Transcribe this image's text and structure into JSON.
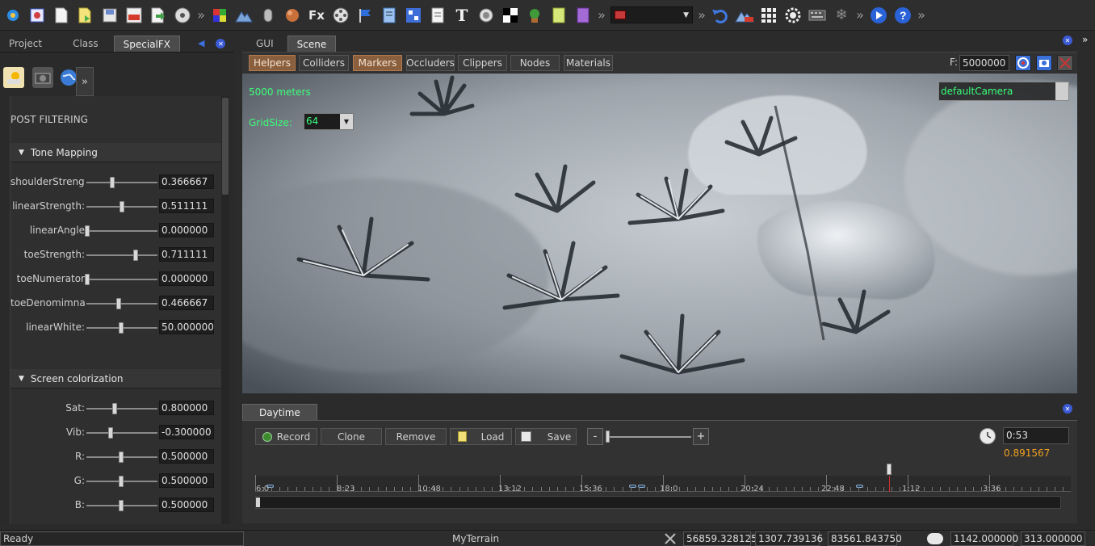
{
  "toolbar": {
    "overflow_glyph": "»",
    "fx_label": "Fx",
    "text_tool_label": "T",
    "combo_value": "",
    "icons": [
      "app-icon",
      "class-icon",
      "new-file-icon",
      "open-file-icon",
      "save-icon",
      "export-icon",
      "import-icon",
      "disc-icon",
      "cube-icon",
      "terrain-icon",
      "mouse-icon",
      "sphere-icon",
      "fx-icon",
      "film-reel-icon",
      "flag-icon",
      "script-icon",
      "network-icon",
      "notes-icon",
      "text-icon",
      "speaker-icon",
      "checker-icon",
      "plant-icon",
      "paper-icon",
      "book-icon",
      "undo-icon",
      "terrain-new-icon",
      "grid-icon",
      "gear-icon",
      "keyboard-icon",
      "snowflake-icon",
      "play-icon",
      "help-icon"
    ],
    "colors": {
      "accent_blue": "#3b6fd9",
      "help_blue": "#2d64d8"
    }
  },
  "left_tabs": [
    "Project",
    "Class",
    "SpecialFX"
  ],
  "left_active_tab": "SpecialFX",
  "side": {
    "more_glyph": "»",
    "post_filtering": "POST FILTERING",
    "tone_mapping": {
      "title": "Tone Mapping",
      "rows": [
        {
          "label": "shoulderStrengt",
          "value": "0.366667",
          "fraction": 0.37
        },
        {
          "label": "linearStrength:",
          "value": "0.511111",
          "fraction": 0.51
        },
        {
          "label": "linearAngle",
          "value": "0.000000",
          "fraction": 0.0
        },
        {
          "label": "toeStrength:",
          "value": "0.711111",
          "fraction": 0.71
        },
        {
          "label": "toeNumerator",
          "value": "0.000000",
          "fraction": 0.0
        },
        {
          "label": "toeDenomimnat",
          "value": "0.466667",
          "fraction": 0.47
        },
        {
          "label": "linearWhite:",
          "value": "50.000000",
          "fraction": 0.5
        }
      ]
    },
    "screen_colorization": {
      "title": "Screen colorization",
      "rows": [
        {
          "label": "Sat:",
          "value": "0.800000",
          "fraction": 0.4
        },
        {
          "label": "Vib:",
          "value": "-0.300000",
          "fraction": 0.35
        },
        {
          "label": "R:",
          "value": "0.500000",
          "fraction": 0.5
        },
        {
          "label": "G:",
          "value": "0.500000",
          "fraction": 0.5
        },
        {
          "label": "B:",
          "value": "0.500000",
          "fraction": 0.5
        }
      ]
    }
  },
  "main_tabs": [
    "GUI",
    "Scene"
  ],
  "main_active_tab": "Scene",
  "viewbar": {
    "buttons": [
      {
        "label": "Helpers",
        "on": true
      },
      {
        "label": "Colliders",
        "on": false
      },
      {
        "label": "Markers",
        "on": true
      },
      {
        "label": "Occluders",
        "on": false
      },
      {
        "label": "Clippers",
        "on": false
      },
      {
        "label": "Nodes",
        "on": false
      },
      {
        "label": "Materials",
        "on": false
      }
    ],
    "f_label": "F:",
    "f_value": "5000000"
  },
  "viewport": {
    "meters": "5000 meters",
    "grid_label": "GridSize:",
    "grid_value": "64",
    "camera": "defaultCamera"
  },
  "daytime": {
    "tab": "Daytime",
    "record": "Record",
    "clone": "Clone",
    "remove": "Remove",
    "load": "Load",
    "save": "Save",
    "minus": "-",
    "plus": "+",
    "time": "0:53",
    "value": "0.891567",
    "timeline_labels": [
      "6:0",
      "8:23",
      "10:48",
      "13:12",
      "15:36",
      "18:0",
      "20:24",
      "22:48",
      "1:12",
      "3:36"
    ]
  },
  "status": {
    "ready": "Ready",
    "terrain": "MyTerrain",
    "coord_x": "56859.328125",
    "coord_y": "1307.739136",
    "coord_z": "83561.843750",
    "v1": "1142.000000",
    "v2": "313.000000"
  }
}
